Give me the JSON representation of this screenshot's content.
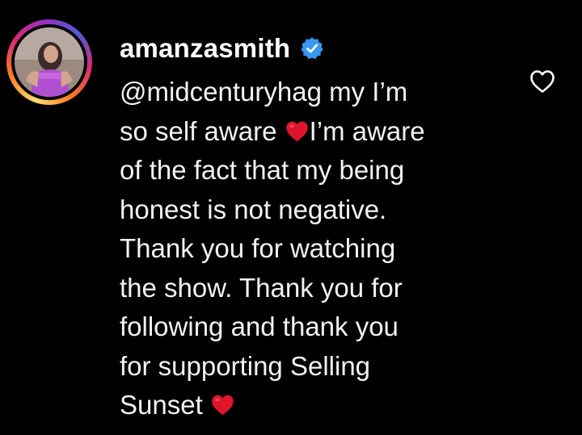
{
  "comment": {
    "username": "amanzasmith",
    "mention": "@midcenturyhag",
    "lines": [
      " my I’m",
      "so self aware ",
      "I’m aware",
      "of the fact that my being",
      "honest is not negative.",
      "Thank you for watching",
      "the show. Thank you for",
      "following and thank you",
      "for supporting Selling",
      "Sunset "
    ],
    "icons": {
      "verified": "verified-badge-icon",
      "like": "heart-outline-icon",
      "emoji": "red-heart-emoji"
    }
  },
  "colors": {
    "background": "#000000",
    "text": "#f2f2f2",
    "verified": "#3897f0",
    "heart": "#e0152b"
  }
}
